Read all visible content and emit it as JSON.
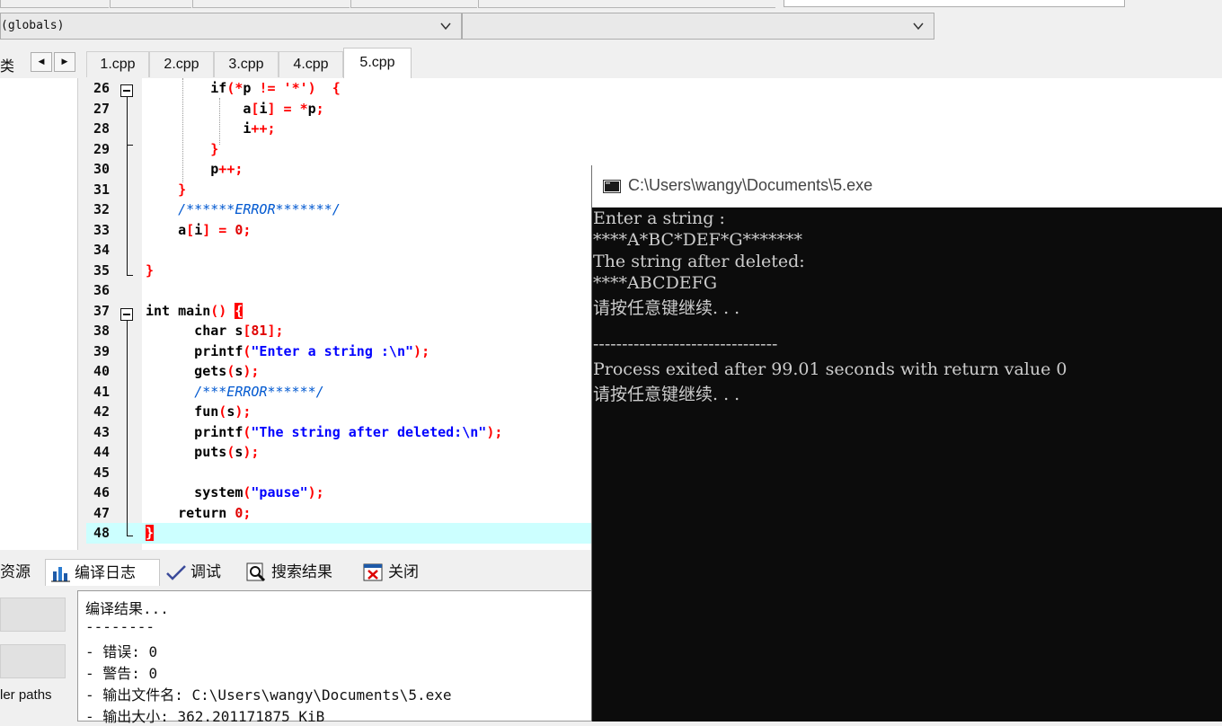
{
  "toolbar": {
    "scope_combo": "(globals)",
    "member_combo": "",
    "class_label": "类"
  },
  "tabs": {
    "nav_prev": "◀",
    "nav_next": "▶",
    "files": [
      "1.cpp",
      "2.cpp",
      "3.cpp",
      "4.cpp",
      "5.cpp"
    ],
    "active": "5.cpp"
  },
  "editor": {
    "lines": [
      {
        "n": "26",
        "code": "        if(*p != '*')  {"
      },
      {
        "n": "27",
        "code": "            a[i] = *p;"
      },
      {
        "n": "28",
        "code": "            i++;"
      },
      {
        "n": "29",
        "code": "        }"
      },
      {
        "n": "30",
        "code": "        p++;"
      },
      {
        "n": "31",
        "code": "    }"
      },
      {
        "n": "32",
        "code": "    /******ERROR*******/"
      },
      {
        "n": "33",
        "code": "    a[i] = 0;"
      },
      {
        "n": "34",
        "code": ""
      },
      {
        "n": "35",
        "code": "}"
      },
      {
        "n": "36",
        "code": ""
      },
      {
        "n": "37",
        "code": "int main() {"
      },
      {
        "n": "38",
        "code": "      char s[81];"
      },
      {
        "n": "39",
        "code": "      printf(\"Enter a string :\\n\");"
      },
      {
        "n": "40",
        "code": "      gets(s);"
      },
      {
        "n": "41",
        "code": "      /***ERROR******/"
      },
      {
        "n": "42",
        "code": "      fun(s);"
      },
      {
        "n": "43",
        "code": "      printf(\"The string after deleted:\\n\");"
      },
      {
        "n": "44",
        "code": "      puts(s);"
      },
      {
        "n": "45",
        "code": ""
      },
      {
        "n": "46",
        "code": "      system(\"pause\");"
      },
      {
        "n": "47",
        "code": "    return 0;"
      },
      {
        "n": "48",
        "code": "}"
      }
    ]
  },
  "bottom_tabs": {
    "resources": "资源",
    "compile_log": "编译日志",
    "debug": "调试",
    "search_results": "搜索结果",
    "close": "关闭"
  },
  "bottom_left": {
    "paths_label": "ler paths"
  },
  "compile_log": [
    "编译结果...",
    "--------",
    "- 错误: 0",
    "- 警告: 0",
    "- 输出文件名: C:\\Users\\wangy\\Documents\\5.exe",
    "- 输出大小: 362.201171875 KiB"
  ],
  "console": {
    "title": "C:\\Users\\wangy\\Documents\\5.exe",
    "lines": [
      "Enter a string :",
      "****A*BC*DEF*G*******",
      "The string after deleted:",
      "****ABCDEFG",
      "请按任意键继续. . .",
      "",
      "--------------------------------",
      "Process exited after 99.01 seconds with return value 0",
      "请按任意键继续. . ."
    ]
  }
}
